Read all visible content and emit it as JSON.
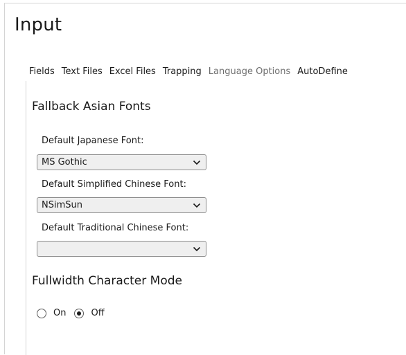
{
  "page": {
    "title": "Input"
  },
  "tabs": [
    {
      "label": "Fields",
      "active": false
    },
    {
      "label": "Text Files",
      "active": false
    },
    {
      "label": "Excel Files",
      "active": false
    },
    {
      "label": "Trapping",
      "active": false
    },
    {
      "label": "Language Options",
      "active": true
    },
    {
      "label": "AutoDefine",
      "active": false
    }
  ],
  "fallback_fonts": {
    "heading": "Fallback Asian Fonts",
    "japanese": {
      "label": "Default Japanese Font:",
      "value": "MS Gothic"
    },
    "simplified_chinese": {
      "label": "Default Simplified Chinese Font:",
      "value": "NSimSun"
    },
    "traditional_chinese": {
      "label": "Default Traditional Chinese Font:",
      "value": ""
    }
  },
  "fullwidth_mode": {
    "heading": "Fullwidth Character Mode",
    "options": [
      {
        "label": "On",
        "selected": false
      },
      {
        "label": "Off",
        "selected": true
      }
    ]
  },
  "colors": {
    "active_tab_text": "#6e6e6e",
    "dropdown_bg": "#efefef",
    "border": "#d4d4d4"
  }
}
